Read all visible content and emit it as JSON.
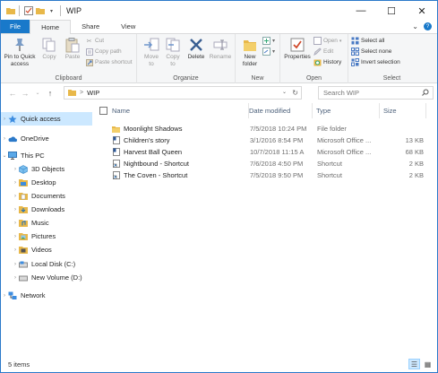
{
  "window": {
    "title": "WIP",
    "minimize": "—",
    "maximize": "☐",
    "close": "✕"
  },
  "tabs": [
    {
      "label": "File"
    },
    {
      "label": "Home"
    },
    {
      "label": "Share"
    },
    {
      "label": "View"
    }
  ],
  "ribbon": {
    "clipboard": {
      "pin_label": "Pin to Quick\naccess",
      "copy_label": "Copy",
      "paste_label": "Paste",
      "cut_label": "Cut",
      "copy_path_label": "Copy path",
      "paste_shortcut_label": "Paste shortcut",
      "group_label": "Clipboard"
    },
    "organize": {
      "move_to_label": "Move\nto",
      "copy_to_label": "Copy\nto",
      "delete_label": "Delete",
      "rename_label": "Rename",
      "group_label": "Organize"
    },
    "new": {
      "new_folder_label": "New\nfolder",
      "group_label": "New"
    },
    "open": {
      "properties_label": "Properties",
      "open_label": "Open",
      "edit_label": "Edit",
      "history_label": "History",
      "group_label": "Open"
    },
    "select": {
      "select_all_label": "Select all",
      "select_none_label": "Select none",
      "invert_label": "Invert selection",
      "group_label": "Select"
    }
  },
  "address": {
    "path": "WIP",
    "search_placeholder": "Search WIP"
  },
  "nav_pane": {
    "items": [
      {
        "label": "Quick access",
        "icon": "star-icon",
        "selected": true
      },
      {
        "label": "OneDrive",
        "icon": "cloud-icon",
        "selected": false
      },
      {
        "label": "This PC",
        "icon": "computer-icon",
        "selected": false
      },
      {
        "label": "3D Objects",
        "icon": "cube-icon",
        "selected": false
      },
      {
        "label": "Desktop",
        "icon": "desktop-folder-icon",
        "selected": false
      },
      {
        "label": "Documents",
        "icon": "documents-folder-icon",
        "selected": false
      },
      {
        "label": "Downloads",
        "icon": "downloads-folder-icon",
        "selected": false
      },
      {
        "label": "Music",
        "icon": "music-folder-icon",
        "selected": false
      },
      {
        "label": "Pictures",
        "icon": "pictures-folder-icon",
        "selected": false
      },
      {
        "label": "Videos",
        "icon": "videos-folder-icon",
        "selected": false
      },
      {
        "label": "Local Disk (C:)",
        "icon": "drive-icon",
        "selected": false
      },
      {
        "label": "New Volume (D:)",
        "icon": "drive-icon",
        "selected": false
      },
      {
        "label": "Network",
        "icon": "network-icon",
        "selected": false
      }
    ]
  },
  "file_list": {
    "columns": {
      "name": "Name",
      "date": "Date modified",
      "type": "Type",
      "size": "Size"
    },
    "rows": [
      {
        "name": "Moonlight Shadows",
        "date": "7/5/2018 10:24 PM",
        "type": "File folder",
        "size": "",
        "icon": "folder-icon"
      },
      {
        "name": "Children's story",
        "date": "3/1/2016 8:54 PM",
        "type": "Microsoft Office ...",
        "size": "13 KB",
        "icon": "word-document-icon"
      },
      {
        "name": "Harvest Ball Queen",
        "date": "10/7/2018 11:15 A",
        "type": "Microsoft Office ...",
        "size": "68 KB",
        "icon": "word-document-icon"
      },
      {
        "name": "Nightbound - Shortcut",
        "date": "7/6/2018 4:50 PM",
        "type": "Shortcut",
        "size": "2 KB",
        "icon": "shortcut-icon"
      },
      {
        "name": "The Coven - Shortcut",
        "date": "7/5/2018 9:50 PM",
        "type": "Shortcut",
        "size": "2 KB",
        "icon": "shortcut-icon"
      }
    ]
  },
  "status": {
    "count": "5 items"
  },
  "colors": {
    "accent": "#1979ca",
    "selection": "#cce8ff",
    "folder": "#e8b84a"
  }
}
